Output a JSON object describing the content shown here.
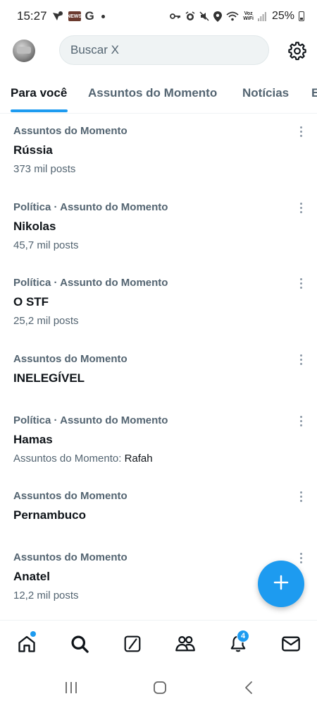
{
  "status_bar": {
    "time": "15:27",
    "icons_left": [
      "maps-pin-icon",
      "news-app-icon",
      "google-icon",
      "more-dot-icon"
    ],
    "news_label": "NEWS",
    "google_label": "G",
    "voz_wifi": "Voz\nWiFi",
    "battery_percent": "25%",
    "icons_right": [
      "key-icon",
      "alarm-icon",
      "mute-icon",
      "location-icon",
      "wifi-icon",
      "voz-wifi-icon",
      "signal-icon",
      "battery-icon"
    ]
  },
  "header": {
    "avatar": "avatar",
    "search_placeholder": "Buscar X",
    "settings_icon": "gear-icon"
  },
  "tabs": [
    {
      "label": "Para você",
      "active": true
    },
    {
      "label": "Assuntos do Momento",
      "active": false
    },
    {
      "label": "Notícias",
      "active": false
    },
    {
      "label": "E",
      "active": false
    }
  ],
  "trends": [
    {
      "category": "Assuntos do Momento",
      "name": "Rússia",
      "count": "373 mil posts"
    },
    {
      "category": "Política · Assunto do Momento",
      "name": "Nikolas",
      "count": "45,7 mil posts"
    },
    {
      "category": "Política · Assunto do Momento",
      "name": "O STF",
      "count": "25,2 mil posts"
    },
    {
      "category": "Assuntos do Momento",
      "name": "INELEGÍVEL",
      "count": ""
    },
    {
      "category": "Política · Assunto do Momento",
      "name": "Hamas",
      "count_prefix": "Assuntos do Momento: ",
      "count_related": "Rafah"
    },
    {
      "category": "Assuntos do Momento",
      "name": "Pernambuco",
      "count": ""
    },
    {
      "category": "Assuntos do Momento",
      "name": "Anatel",
      "count": "12,2 mil posts"
    }
  ],
  "fab": {
    "icon": "plus-icon"
  },
  "bottom_nav": {
    "items": [
      "home-icon",
      "search-icon",
      "grok-icon",
      "communities-icon",
      "notifications-icon",
      "messages-icon"
    ],
    "notification_badge": "4"
  },
  "colors": {
    "accent": "#1d9bf0",
    "primary_text": "#0f1419",
    "secondary_text": "#536471",
    "search_bg": "#eff3f4"
  }
}
